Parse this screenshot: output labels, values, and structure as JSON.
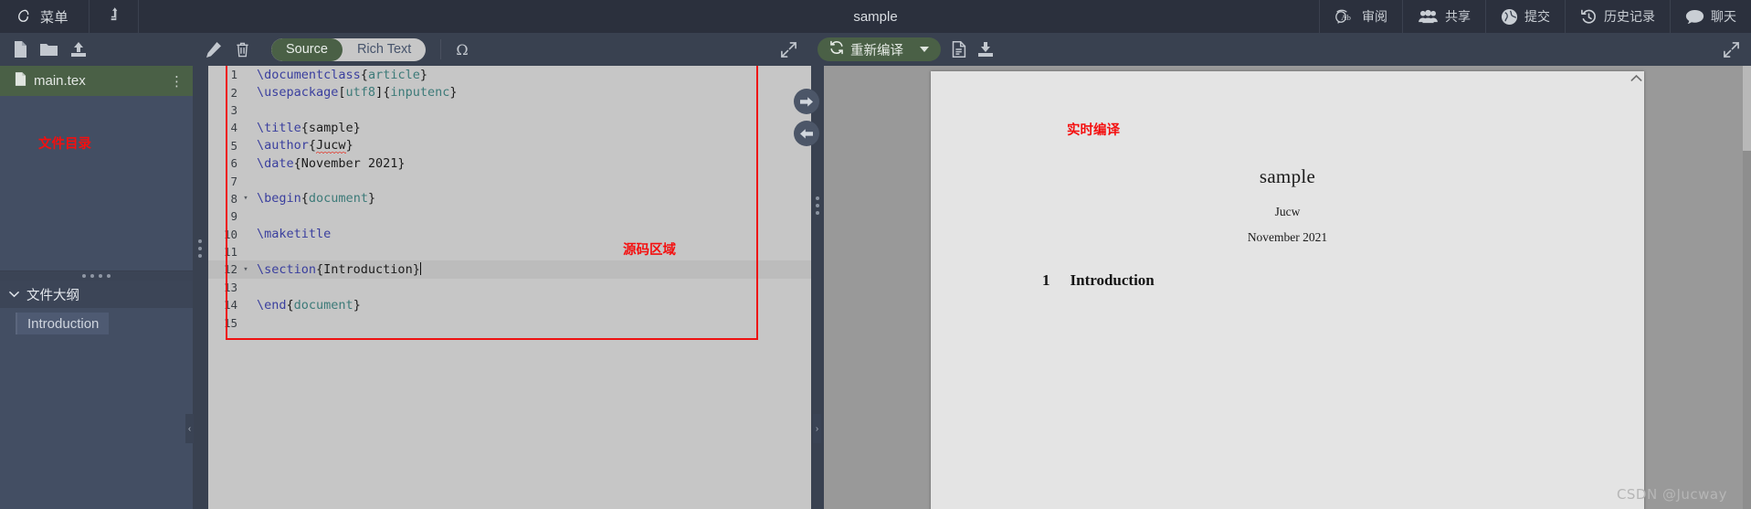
{
  "topbar": {
    "menu_label": "菜单",
    "doc_title": "sample",
    "upload_icon": "upload-arrow-icon",
    "right_items": [
      {
        "label": "审阅",
        "icon": "review-icon"
      },
      {
        "label": "共享",
        "icon": "share-people-icon"
      },
      {
        "label": "提交",
        "icon": "submit-globe-icon"
      },
      {
        "label": "历史记录",
        "icon": "history-clock-icon"
      },
      {
        "label": "聊天",
        "icon": "chat-bubble-icon"
      }
    ]
  },
  "toolbar": {
    "file_icons": [
      {
        "name": "new-file-icon"
      },
      {
        "name": "new-folder-icon"
      },
      {
        "name": "upload-file-icon"
      }
    ],
    "edit_icons": [
      {
        "name": "rename-pencil-icon"
      },
      {
        "name": "delete-trash-icon"
      }
    ],
    "mode_tabs": [
      {
        "label": "Source",
        "active": true
      },
      {
        "label": "Rich Text",
        "active": false
      }
    ],
    "symbol_button": "Ω",
    "editor_expand_icon": "expand-arrows-icon",
    "compile_label": "重新编译",
    "compile_icon": "refresh-icon",
    "compile_dropdown_icon": "chevron-down-icon",
    "pdf_icons": [
      {
        "name": "pdf-file-icon"
      },
      {
        "name": "download-icon"
      }
    ],
    "pdf_expand_icon": "expand-arrows-icon"
  },
  "sidebar": {
    "file": {
      "name": "main.tex",
      "icon": "file-icon",
      "menu_icon": "more-vertical-icon"
    },
    "annotation_file_tree": "文件目录",
    "outline": {
      "title": "文件大纲",
      "chevron": "chevron-down-icon",
      "items": [
        {
          "label": "Introduction",
          "active": true
        }
      ]
    },
    "collapse_icon": "collapse-left-icon"
  },
  "editor": {
    "annotation": "源码区域",
    "lines": [
      {
        "n": "1",
        "fold": false,
        "tokens": [
          {
            "t": "\\documentclass",
            "c": "cmd"
          },
          {
            "t": "{",
            "c": "brace"
          },
          {
            "t": "article",
            "c": "arg"
          },
          {
            "t": "}",
            "c": "brace"
          }
        ]
      },
      {
        "n": "2",
        "fold": false,
        "tokens": [
          {
            "t": "\\usepackage",
            "c": "cmd"
          },
          {
            "t": "[",
            "c": "brace"
          },
          {
            "t": "utf8",
            "c": "arg"
          },
          {
            "t": "]{",
            "c": "brace"
          },
          {
            "t": "inputenc",
            "c": "arg"
          },
          {
            "t": "}",
            "c": "brace"
          }
        ]
      },
      {
        "n": "3",
        "fold": false,
        "tokens": []
      },
      {
        "n": "4",
        "fold": false,
        "tokens": [
          {
            "t": "\\title",
            "c": "cmd"
          },
          {
            "t": "{sample}",
            "c": "brace"
          }
        ]
      },
      {
        "n": "5",
        "fold": false,
        "tokens": [
          {
            "t": "\\author",
            "c": "cmd"
          },
          {
            "t": "{",
            "c": "brace"
          },
          {
            "t": "Jucw",
            "c": "misspell"
          },
          {
            "t": "}",
            "c": "brace"
          }
        ]
      },
      {
        "n": "6",
        "fold": false,
        "tokens": [
          {
            "t": "\\date",
            "c": "cmd"
          },
          {
            "t": "{November 2021}",
            "c": "brace"
          }
        ]
      },
      {
        "n": "7",
        "fold": false,
        "tokens": []
      },
      {
        "n": "8",
        "fold": true,
        "tokens": [
          {
            "t": "\\begin",
            "c": "cmd"
          },
          {
            "t": "{",
            "c": "brace"
          },
          {
            "t": "document",
            "c": "arg"
          },
          {
            "t": "}",
            "c": "brace"
          }
        ]
      },
      {
        "n": "9",
        "fold": false,
        "tokens": []
      },
      {
        "n": "10",
        "fold": false,
        "tokens": [
          {
            "t": "\\maketitle",
            "c": "cmd"
          }
        ]
      },
      {
        "n": "11",
        "fold": false,
        "tokens": []
      },
      {
        "n": "12",
        "fold": true,
        "active": true,
        "caret": true,
        "tokens": [
          {
            "t": "\\section",
            "c": "cmd"
          },
          {
            "t": "{Introduction}",
            "c": "brace"
          }
        ]
      },
      {
        "n": "13",
        "fold": false,
        "tokens": []
      },
      {
        "n": "14",
        "fold": false,
        "tokens": [
          {
            "t": "\\end",
            "c": "cmd"
          },
          {
            "t": "{",
            "c": "brace"
          },
          {
            "t": "document",
            "c": "arg"
          },
          {
            "t": "}",
            "c": "brace"
          }
        ]
      },
      {
        "n": "15",
        "fold": false,
        "tokens": []
      }
    ]
  },
  "splitter": {
    "forward_icon": "arrow-right-circle-icon",
    "back_icon": "arrow-left-circle-icon",
    "collapse_icon": "collapse-right-icon"
  },
  "pdf": {
    "annotation": "实时编译",
    "title": "sample",
    "author": "Jucw",
    "date": "November 2021",
    "section_number": "1",
    "section_title": "Introduction",
    "scroll_up_icon": "chevron-up-icon"
  },
  "watermark": "CSDN @Jucway",
  "colors": {
    "accent_green": "#4a6046",
    "panel_dark": "#394150",
    "sidebar": "#434e63",
    "annotation_red": "#f40f0f",
    "editor_bg": "#c6c6c6"
  }
}
